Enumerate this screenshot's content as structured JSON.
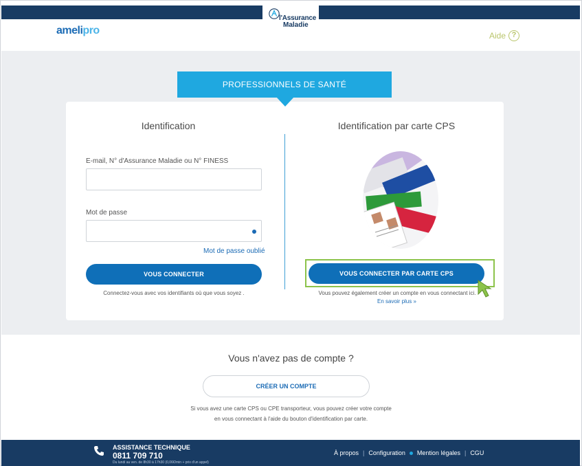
{
  "header": {
    "logo_line1": "l'Assurance",
    "logo_line2": "Maladie",
    "brand_main": "ameli",
    "brand_pro": "pro",
    "help_label": "Aide",
    "help_icon_text": "?"
  },
  "banner": {
    "title": "PROFESSIONNELS DE SANTÉ"
  },
  "login": {
    "title": "Identification",
    "email_label": "E-mail, N° d'Assurance Maladie ou N° FINESS",
    "email_value": "",
    "password_label": "Mot de passe",
    "password_value": "",
    "forgot_label": "Mot de passe oublié",
    "submit_label": "VOUS CONNECTER",
    "hint": "Connectez-vous avec vos identifiants où que vous soyez ."
  },
  "cps": {
    "title": "Identification par carte CPS",
    "submit_label": "VOUS CONNECTER PAR CARTE CPS",
    "hint": "Vous pouvez également créer un compte en vous connectant ici.",
    "learn_more": "En savoir plus »"
  },
  "signup": {
    "question": "Vous n'avez pas de compte ?",
    "button_label": "CRÉER UN COMPTE",
    "info_line1": "Si vous avez une carte CPS ou CPE transporteur, vous pouvez créer votre compte",
    "info_line2": "en vous connectant à l'aide du bouton d'identification par carte."
  },
  "footer": {
    "assist_title": "ASSISTANCE TECHNIQUE",
    "assist_phone": "0811 709 710",
    "assist_hours": "Du lundi au ven. de 8h30 à 17h30 (0,06€/min + prix d'un appel)",
    "links": [
      "À propos",
      "Configuration",
      "Mention légales",
      "CGU"
    ]
  },
  "colors": {
    "navy": "#183b63",
    "accent_blue": "#1fa8e0",
    "button_blue": "#0f6fb8",
    "highlight_green": "#8cc34a",
    "help_olive": "#b9c56b"
  }
}
